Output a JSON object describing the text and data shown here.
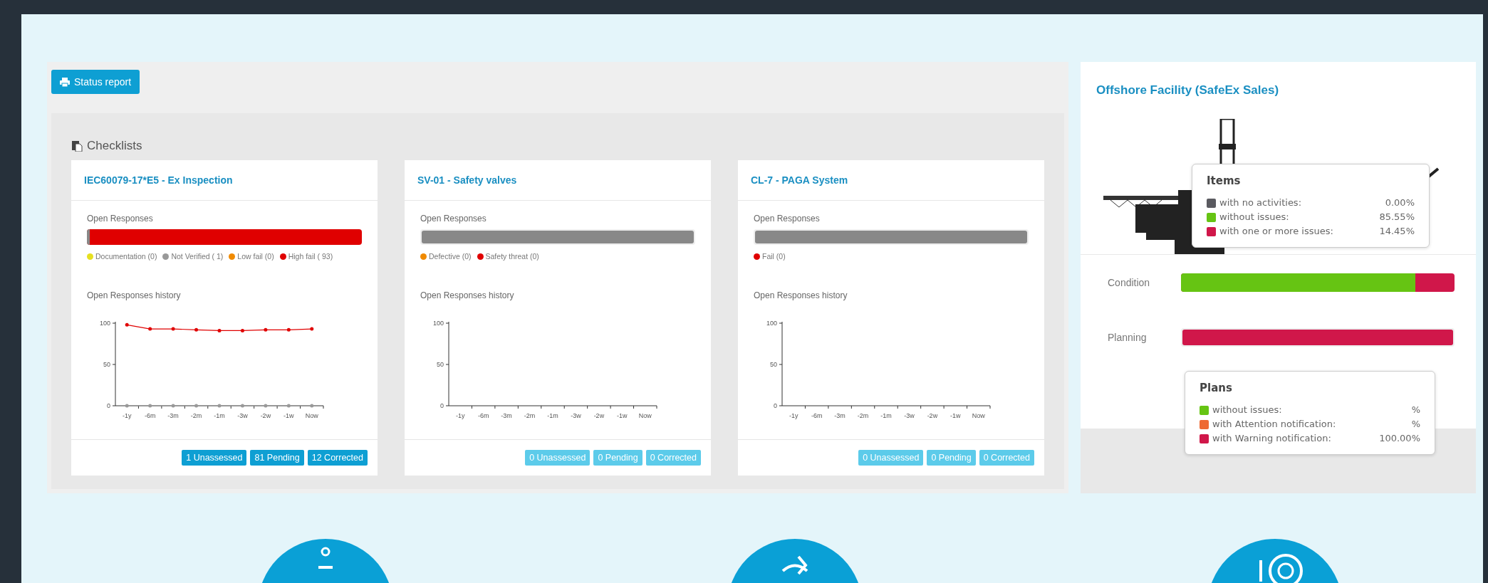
{
  "toolbar": {
    "status_report_button": "Status report"
  },
  "checklists": {
    "title": "Checklists",
    "cards": [
      {
        "title": "IEC60079-17*E5 - Ex Inspection",
        "open_responses_label": "Open Responses",
        "bar": {
          "color": "#888888",
          "level": 0.011,
          "track": {
            "color": "#e00000"
          }
        },
        "legend": [
          {
            "label": "Documentation (0)",
            "color": "#e6e020"
          },
          {
            "label": "Not Verified ( 1)",
            "color": "#999999"
          },
          {
            "label": "Low fail (0)",
            "color": "#f08a00"
          },
          {
            "label": "High fail ( 93)",
            "color": "#e00000"
          }
        ],
        "history_label": "Open Responses history",
        "chart_data": {
          "type": "line",
          "categories": [
            "-1y",
            "-6m",
            "-3m",
            "-2m",
            "-1m",
            "-3w",
            "-2w",
            "-1w",
            "Now"
          ],
          "yticks": [
            0,
            50,
            100
          ],
          "ylim": [
            0,
            100
          ],
          "series": [
            {
              "color": "#e00000",
              "values": [
                98,
                93,
                93,
                92,
                91,
                91,
                92,
                92,
                93
              ]
            },
            {
              "color": "#999999",
              "values": [
                0,
                0,
                0,
                0,
                0,
                0,
                0,
                0,
                0
              ]
            }
          ]
        },
        "badges": [
          {
            "label": "1 Unassessed",
            "disabled": false
          },
          {
            "label": "81 Pending",
            "disabled": false
          },
          {
            "label": "12 Corrected",
            "disabled": false
          }
        ]
      },
      {
        "title": "SV-01 - Safety valves",
        "open_responses_label": "Open Responses",
        "bar": {
          "color": "#888888",
          "level": 1
        },
        "legend": [
          {
            "label": "Defective (0)",
            "color": "#f08a00"
          },
          {
            "label": "Safety threat (0)",
            "color": "#e00000"
          }
        ],
        "history_label": "Open Responses history",
        "chart_data": {
          "type": "line",
          "categories": [
            "-1y",
            "-6m",
            "-3m",
            "-2m",
            "-1m",
            "-3w",
            "-2w",
            "-1w",
            "Now"
          ],
          "yticks": [
            0,
            50,
            100
          ],
          "ylim": [
            0,
            100
          ]
        },
        "badges": [
          {
            "label": "0 Unassessed",
            "disabled": true
          },
          {
            "label": "0 Pending",
            "disabled": true
          },
          {
            "label": "0 Corrected",
            "disabled": true
          }
        ]
      },
      {
        "title": "CL-7 - PAGA System",
        "open_responses_label": "Open Responses",
        "bar": {
          "color": "#888888",
          "level": 1
        },
        "legend": [
          {
            "label": "Fail (0)",
            "color": "#e00000"
          }
        ],
        "history_label": "Open Responses history",
        "chart_data": {
          "type": "line",
          "categories": [
            "-1y",
            "-6m",
            "-3m",
            "-2m",
            "-1m",
            "-3w",
            "-2w",
            "-1w",
            "Now"
          ],
          "yticks": [
            0,
            50,
            100
          ],
          "ylim": [
            0,
            100
          ]
        },
        "badges": [
          {
            "label": "0 Unassessed",
            "disabled": true
          },
          {
            "label": "0 Pending",
            "disabled": true
          },
          {
            "label": "0 Corrected",
            "disabled": true
          }
        ]
      }
    ]
  },
  "facility": {
    "title": "Offshore Facility (SafeEx Sales)",
    "bars": [
      {
        "label": "Condition",
        "color": "#66c413",
        "level": 0.8555,
        "track": {
          "color": "#d0174a"
        }
      },
      {
        "label": "Planning",
        "color": "#d0174a",
        "level": 1
      }
    ],
    "items_tooltip": {
      "title": "Items",
      "rows": [
        {
          "label": "with no activities:",
          "value": "0.00%",
          "color": "#5a5a60"
        },
        {
          "label": "without issues:",
          "value": "85.55%",
          "color": "#66c413"
        },
        {
          "label": "with one or more issues:",
          "value": "14.45%",
          "color": "#d0174a"
        }
      ]
    },
    "plans_tooltip": {
      "title": "Plans",
      "rows": [
        {
          "label": "without issues:",
          "value": "%",
          "color": "#66c413"
        },
        {
          "label": "with Attention notification:",
          "value": "%",
          "color": "#ee6a33"
        },
        {
          "label": "with Warning notification:",
          "value": "100.00%",
          "color": "#d0174a"
        }
      ]
    }
  }
}
